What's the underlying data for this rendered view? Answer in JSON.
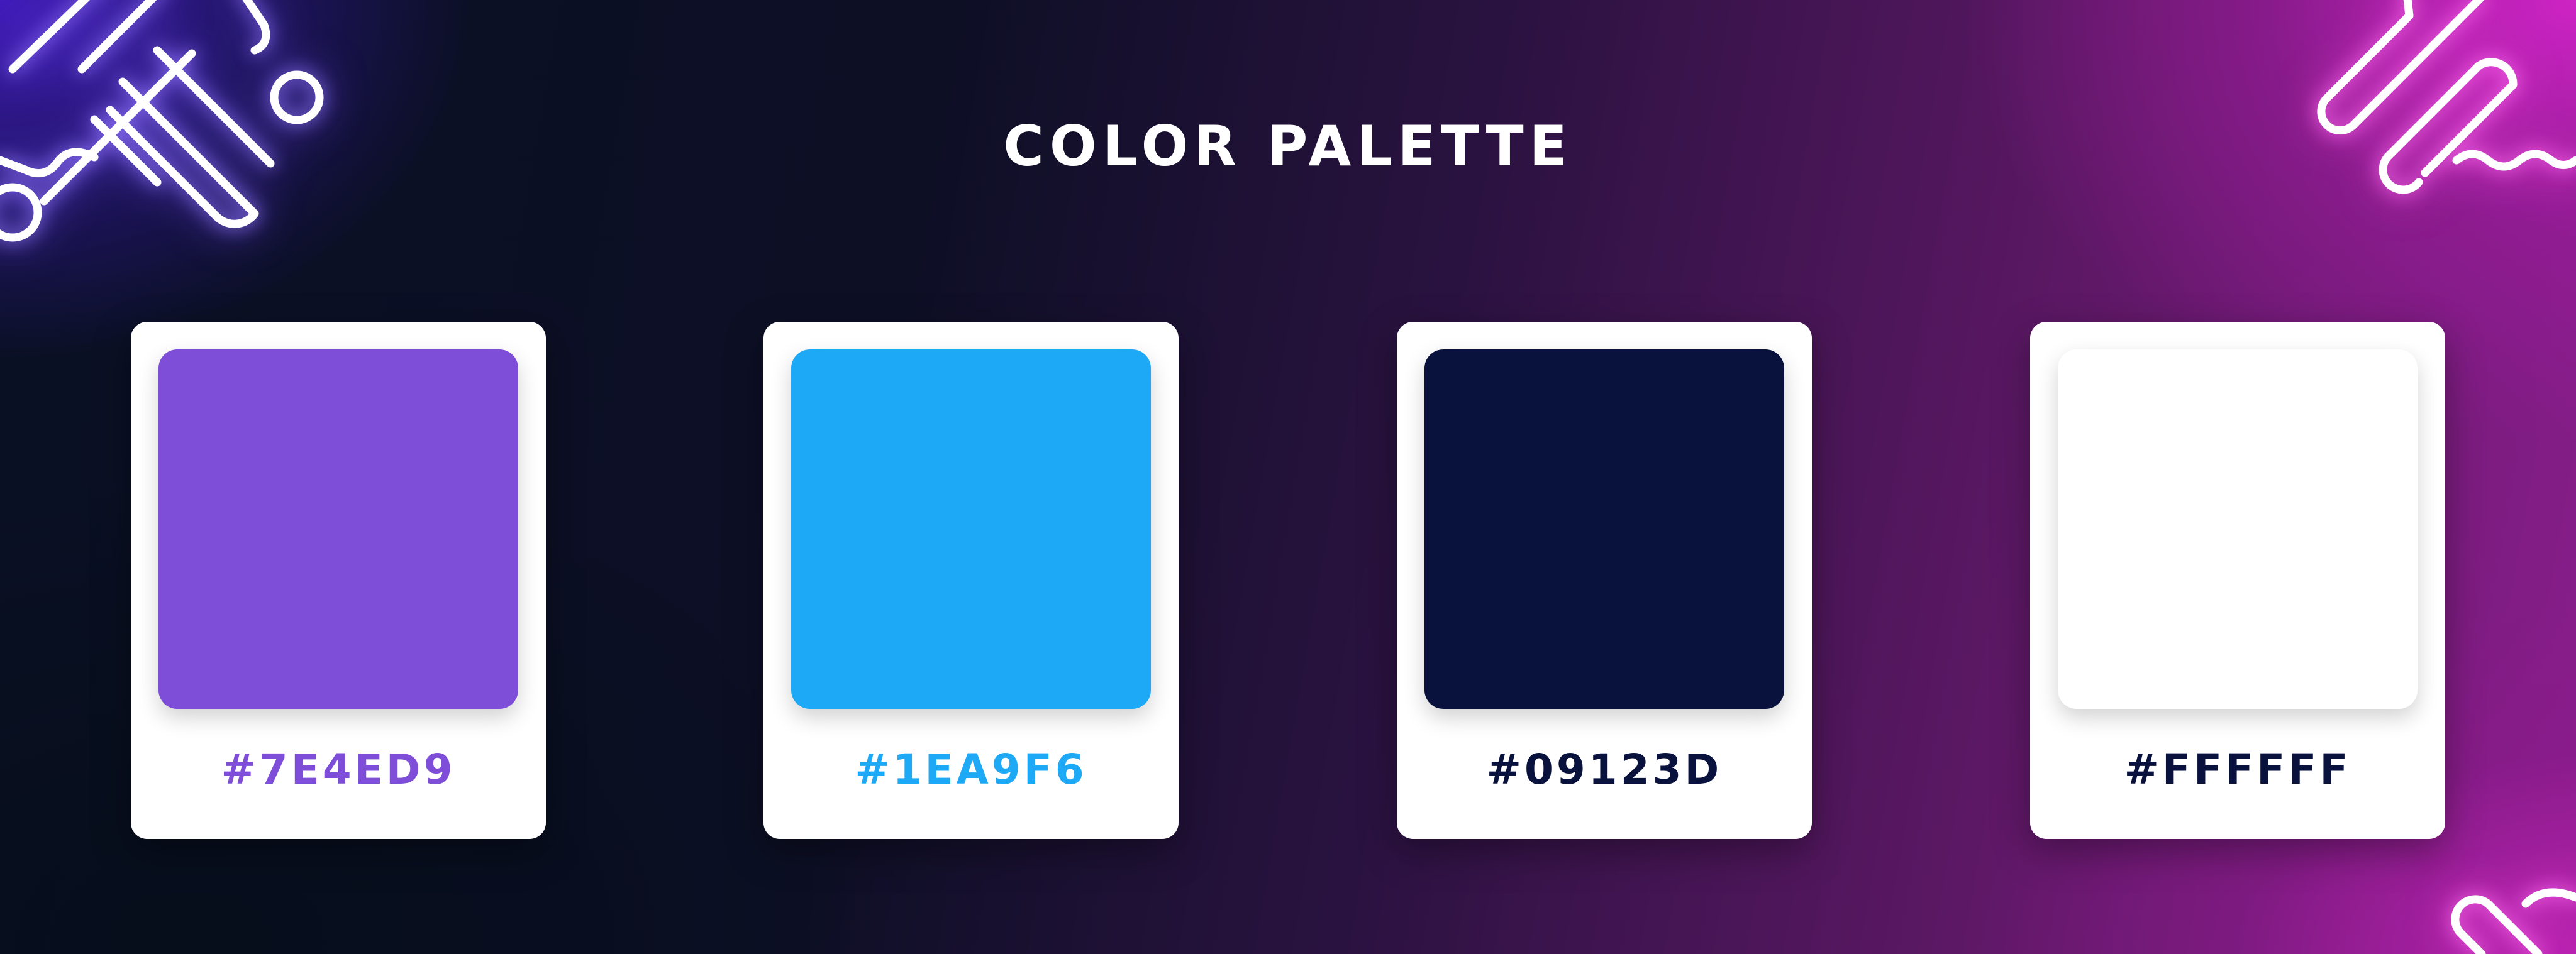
{
  "title": "COLOR PALETTE",
  "colors": [
    {
      "hex_label": "#7E4ED9",
      "swatch": "#7E4ED9",
      "text_color": "#7E4ED9"
    },
    {
      "hex_label": "#1EA9F6",
      "swatch": "#1EA9F6",
      "text_color": "#1EA9F6"
    },
    {
      "hex_label": "#09123D",
      "swatch": "#09123D",
      "text_color": "#09123D"
    },
    {
      "hex_label": "#FFFFFF",
      "swatch": "#FFFFFF",
      "text_color": "#09123D"
    }
  ],
  "background_colors": {
    "top_left_glow": "#4C1ED7",
    "center_dark": "#0A1024",
    "right_magenta": "#D224C8"
  },
  "decorations": [
    "neon-line-left-icon",
    "neon-line-right-icon",
    "neon-line-bottom-right-icon"
  ]
}
